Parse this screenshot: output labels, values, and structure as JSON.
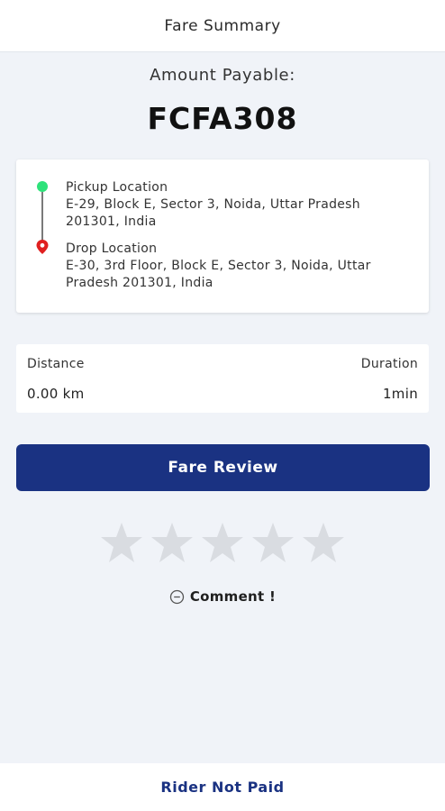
{
  "header": {
    "title": "Fare Summary"
  },
  "amount": {
    "label": "Amount Payable:",
    "value": "FCFA308"
  },
  "pickup": {
    "title": "Pickup Location",
    "address": "E-29, Block E, Sector 3, Noida, Uttar Pradesh 201301, India",
    "marker_color": "#2ee27a"
  },
  "drop": {
    "title": "Drop Location",
    "address": "E-30, 3rd Floor, Block E, Sector 3, Noida, Uttar Pradesh 201301, India",
    "marker_color": "#e02020"
  },
  "trip": {
    "distance_label": "Distance",
    "distance_value": "0.00 km",
    "duration_label": "Duration",
    "duration_value": "1min"
  },
  "fare_review_button": {
    "label": "Fare Review",
    "color": "#1a3282"
  },
  "rating": {
    "max": 5,
    "selected": 0,
    "icon": "star-icon",
    "empty_color": "#d9dce1"
  },
  "comment": {
    "label": "Comment !",
    "icon": "chat-bubble-icon"
  },
  "footer": {
    "label": "Rider Not Paid"
  }
}
